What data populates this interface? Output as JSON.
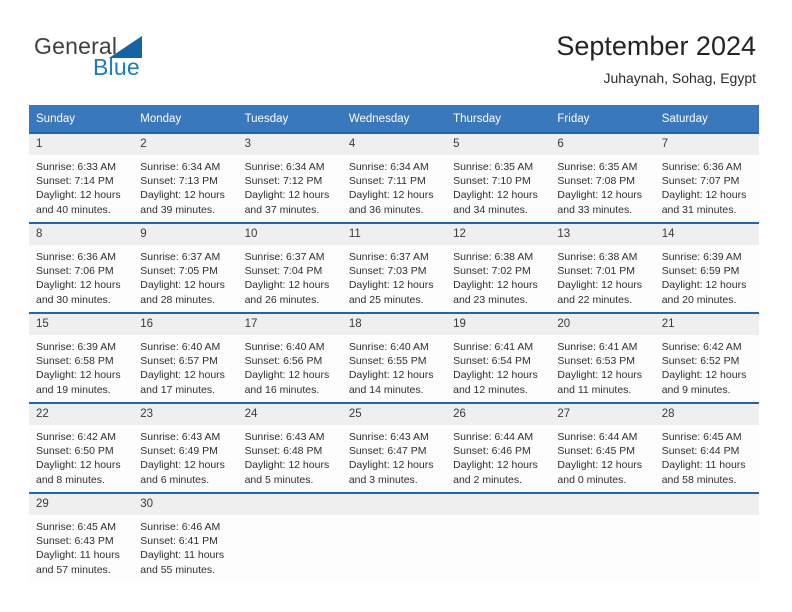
{
  "brand": {
    "name_top": "General",
    "name_bottom": "Blue",
    "triangle_color": "#1464a5",
    "blue_color": "#1a7cc2"
  },
  "header": {
    "title": "September 2024",
    "subtitle": "Juhaynah, Sohag, Egypt",
    "header_bg": "#3978bd",
    "row_rule_color": "#1f66b0",
    "daynum_bg": "#efefef"
  },
  "calendar": {
    "weekday_headers": [
      "Sunday",
      "Monday",
      "Tuesday",
      "Wednesday",
      "Thursday",
      "Friday",
      "Saturday"
    ],
    "labels": {
      "sunrise": "Sunrise:",
      "sunset": "Sunset:",
      "daylight": "Daylight:"
    },
    "weeks": [
      [
        {
          "day": "1",
          "sunrise": "Sunrise: 6:33 AM",
          "sunset": "Sunset: 7:14 PM",
          "daylight_line1": "Daylight: 12 hours",
          "daylight_line2": "and 40 minutes."
        },
        {
          "day": "2",
          "sunrise": "Sunrise: 6:34 AM",
          "sunset": "Sunset: 7:13 PM",
          "daylight_line1": "Daylight: 12 hours",
          "daylight_line2": "and 39 minutes."
        },
        {
          "day": "3",
          "sunrise": "Sunrise: 6:34 AM",
          "sunset": "Sunset: 7:12 PM",
          "daylight_line1": "Daylight: 12 hours",
          "daylight_line2": "and 37 minutes."
        },
        {
          "day": "4",
          "sunrise": "Sunrise: 6:34 AM",
          "sunset": "Sunset: 7:11 PM",
          "daylight_line1": "Daylight: 12 hours",
          "daylight_line2": "and 36 minutes."
        },
        {
          "day": "5",
          "sunrise": "Sunrise: 6:35 AM",
          "sunset": "Sunset: 7:10 PM",
          "daylight_line1": "Daylight: 12 hours",
          "daylight_line2": "and 34 minutes."
        },
        {
          "day": "6",
          "sunrise": "Sunrise: 6:35 AM",
          "sunset": "Sunset: 7:08 PM",
          "daylight_line1": "Daylight: 12 hours",
          "daylight_line2": "and 33 minutes."
        },
        {
          "day": "7",
          "sunrise": "Sunrise: 6:36 AM",
          "sunset": "Sunset: 7:07 PM",
          "daylight_line1": "Daylight: 12 hours",
          "daylight_line2": "and 31 minutes."
        }
      ],
      [
        {
          "day": "8",
          "sunrise": "Sunrise: 6:36 AM",
          "sunset": "Sunset: 7:06 PM",
          "daylight_line1": "Daylight: 12 hours",
          "daylight_line2": "and 30 minutes."
        },
        {
          "day": "9",
          "sunrise": "Sunrise: 6:37 AM",
          "sunset": "Sunset: 7:05 PM",
          "daylight_line1": "Daylight: 12 hours",
          "daylight_line2": "and 28 minutes."
        },
        {
          "day": "10",
          "sunrise": "Sunrise: 6:37 AM",
          "sunset": "Sunset: 7:04 PM",
          "daylight_line1": "Daylight: 12 hours",
          "daylight_line2": "and 26 minutes."
        },
        {
          "day": "11",
          "sunrise": "Sunrise: 6:37 AM",
          "sunset": "Sunset: 7:03 PM",
          "daylight_line1": "Daylight: 12 hours",
          "daylight_line2": "and 25 minutes."
        },
        {
          "day": "12",
          "sunrise": "Sunrise: 6:38 AM",
          "sunset": "Sunset: 7:02 PM",
          "daylight_line1": "Daylight: 12 hours",
          "daylight_line2": "and 23 minutes."
        },
        {
          "day": "13",
          "sunrise": "Sunrise: 6:38 AM",
          "sunset": "Sunset: 7:01 PM",
          "daylight_line1": "Daylight: 12 hours",
          "daylight_line2": "and 22 minutes."
        },
        {
          "day": "14",
          "sunrise": "Sunrise: 6:39 AM",
          "sunset": "Sunset: 6:59 PM",
          "daylight_line1": "Daylight: 12 hours",
          "daylight_line2": "and 20 minutes."
        }
      ],
      [
        {
          "day": "15",
          "sunrise": "Sunrise: 6:39 AM",
          "sunset": "Sunset: 6:58 PM",
          "daylight_line1": "Daylight: 12 hours",
          "daylight_line2": "and 19 minutes."
        },
        {
          "day": "16",
          "sunrise": "Sunrise: 6:40 AM",
          "sunset": "Sunset: 6:57 PM",
          "daylight_line1": "Daylight: 12 hours",
          "daylight_line2": "and 17 minutes."
        },
        {
          "day": "17",
          "sunrise": "Sunrise: 6:40 AM",
          "sunset": "Sunset: 6:56 PM",
          "daylight_line1": "Daylight: 12 hours",
          "daylight_line2": "and 16 minutes."
        },
        {
          "day": "18",
          "sunrise": "Sunrise: 6:40 AM",
          "sunset": "Sunset: 6:55 PM",
          "daylight_line1": "Daylight: 12 hours",
          "daylight_line2": "and 14 minutes."
        },
        {
          "day": "19",
          "sunrise": "Sunrise: 6:41 AM",
          "sunset": "Sunset: 6:54 PM",
          "daylight_line1": "Daylight: 12 hours",
          "daylight_line2": "and 12 minutes."
        },
        {
          "day": "20",
          "sunrise": "Sunrise: 6:41 AM",
          "sunset": "Sunset: 6:53 PM",
          "daylight_line1": "Daylight: 12 hours",
          "daylight_line2": "and 11 minutes."
        },
        {
          "day": "21",
          "sunrise": "Sunrise: 6:42 AM",
          "sunset": "Sunset: 6:52 PM",
          "daylight_line1": "Daylight: 12 hours",
          "daylight_line2": "and 9 minutes."
        }
      ],
      [
        {
          "day": "22",
          "sunrise": "Sunrise: 6:42 AM",
          "sunset": "Sunset: 6:50 PM",
          "daylight_line1": "Daylight: 12 hours",
          "daylight_line2": "and 8 minutes."
        },
        {
          "day": "23",
          "sunrise": "Sunrise: 6:43 AM",
          "sunset": "Sunset: 6:49 PM",
          "daylight_line1": "Daylight: 12 hours",
          "daylight_line2": "and 6 minutes."
        },
        {
          "day": "24",
          "sunrise": "Sunrise: 6:43 AM",
          "sunset": "Sunset: 6:48 PM",
          "daylight_line1": "Daylight: 12 hours",
          "daylight_line2": "and 5 minutes."
        },
        {
          "day": "25",
          "sunrise": "Sunrise: 6:43 AM",
          "sunset": "Sunset: 6:47 PM",
          "daylight_line1": "Daylight: 12 hours",
          "daylight_line2": "and 3 minutes."
        },
        {
          "day": "26",
          "sunrise": "Sunrise: 6:44 AM",
          "sunset": "Sunset: 6:46 PM",
          "daylight_line1": "Daylight: 12 hours",
          "daylight_line2": "and 2 minutes."
        },
        {
          "day": "27",
          "sunrise": "Sunrise: 6:44 AM",
          "sunset": "Sunset: 6:45 PM",
          "daylight_line1": "Daylight: 12 hours",
          "daylight_line2": "and 0 minutes."
        },
        {
          "day": "28",
          "sunrise": "Sunrise: 6:45 AM",
          "sunset": "Sunset: 6:44 PM",
          "daylight_line1": "Daylight: 11 hours",
          "daylight_line2": "and 58 minutes."
        }
      ],
      [
        {
          "day": "29",
          "sunrise": "Sunrise: 6:45 AM",
          "sunset": "Sunset: 6:43 PM",
          "daylight_line1": "Daylight: 11 hours",
          "daylight_line2": "and 57 minutes."
        },
        {
          "day": "30",
          "sunrise": "Sunrise: 6:46 AM",
          "sunset": "Sunset: 6:41 PM",
          "daylight_line1": "Daylight: 11 hours",
          "daylight_line2": "and 55 minutes."
        },
        {
          "day": "",
          "sunrise": "",
          "sunset": "",
          "daylight_line1": "",
          "daylight_line2": ""
        },
        {
          "day": "",
          "sunrise": "",
          "sunset": "",
          "daylight_line1": "",
          "daylight_line2": ""
        },
        {
          "day": "",
          "sunrise": "",
          "sunset": "",
          "daylight_line1": "",
          "daylight_line2": ""
        },
        {
          "day": "",
          "sunrise": "",
          "sunset": "",
          "daylight_line1": "",
          "daylight_line2": ""
        },
        {
          "day": "",
          "sunrise": "",
          "sunset": "",
          "daylight_line1": "",
          "daylight_line2": ""
        }
      ]
    ]
  }
}
